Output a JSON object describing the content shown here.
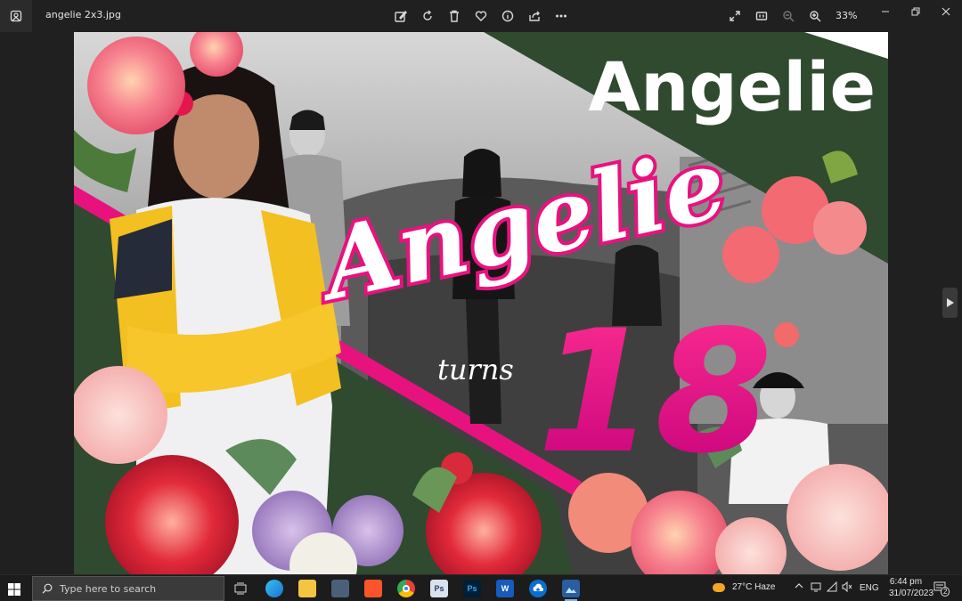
{
  "window": {
    "file_name": "angelie 2x3.jpg",
    "zoom_level": "33%"
  },
  "toolbar": {
    "icons": [
      "edit-image-icon",
      "rotate-icon",
      "delete-icon",
      "favorite-icon",
      "info-icon",
      "share-icon",
      "more-icon"
    ],
    "right_icons": [
      "fullscreen-icon",
      "actual-size-icon",
      "zoom-out-icon",
      "zoom-in-icon"
    ]
  },
  "image": {
    "headline": "Angelie",
    "script_name": "Angelie",
    "turns_text": "turns",
    "age": "18",
    "colors": {
      "green": "#2f4a2e",
      "magenta": "#e8127f",
      "pink": "#ff2f92"
    }
  },
  "taskbar": {
    "search_placeholder": "Type here to search",
    "weather": "27°C  Haze",
    "language": "ENG",
    "time": "6:44 pm",
    "date": "31/07/2023",
    "notification_count": "2"
  }
}
